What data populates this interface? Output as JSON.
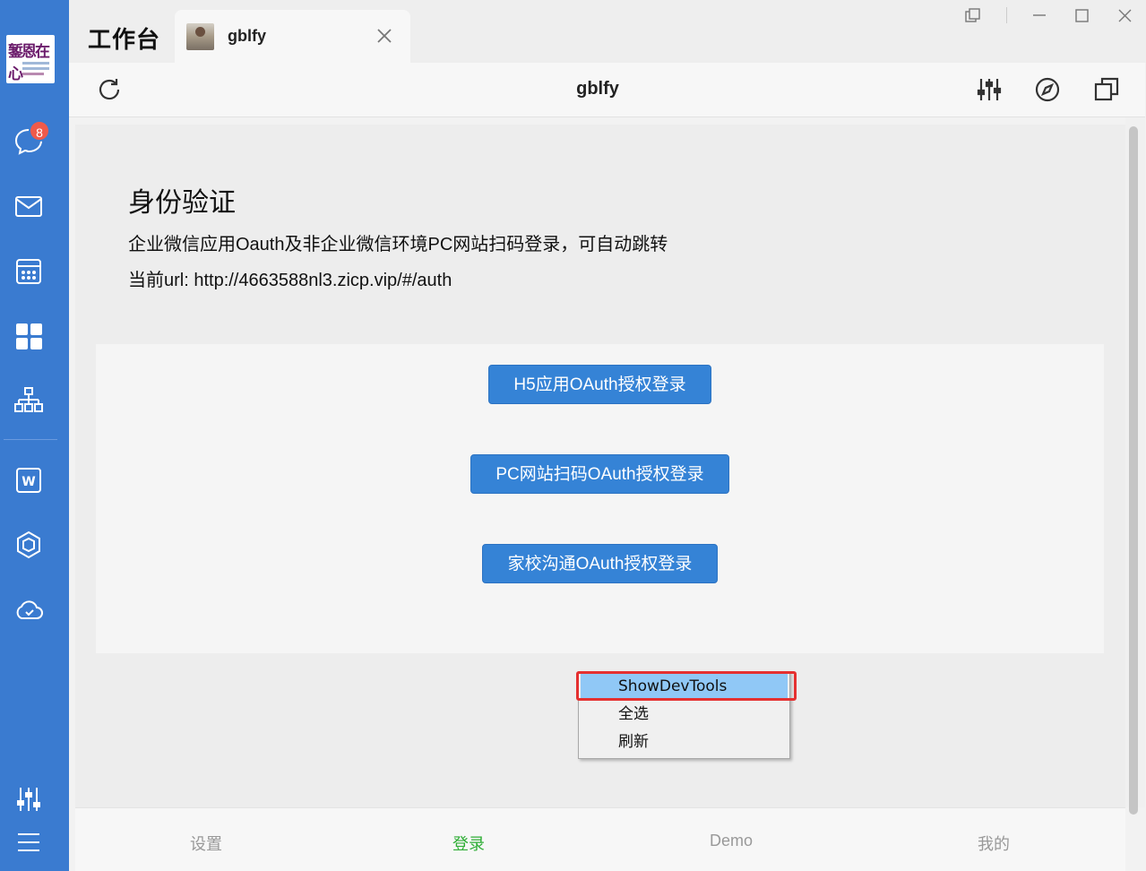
{
  "sidebar": {
    "avatar_text": "錾恩在心",
    "unread_badge": "8",
    "icons": [
      "chat-icon",
      "mail-icon",
      "calendar-icon",
      "workbench-icon",
      "org-chart-icon",
      "wedoc-icon",
      "cube-icon",
      "cloud-icon",
      "settings-sliders-icon",
      "menu-icon"
    ]
  },
  "titlebar": {
    "app_title": "工作台",
    "tab_label": "gblfy"
  },
  "toolbar": {
    "page_title": "gblfy"
  },
  "page": {
    "heading": "身份验证",
    "description": "企业微信应用Oauth及非企业微信环境PC网站扫码登录，可自动跳转",
    "current_url": "当前url: http://4663588nl3.zicp.vip/#/auth",
    "buttons": {
      "h5_oauth": "H5应用OAuth授权登录",
      "pc_scan_oauth": "PC网站扫码OAuth授权登录",
      "school_oauth": "家校沟通OAuth授权登录"
    }
  },
  "context_menu": {
    "items": [
      "ShowDevTools",
      "全选",
      "刷新"
    ],
    "highlighted": "ShowDevTools"
  },
  "bottom_nav": {
    "items": [
      "设置",
      "登录",
      "Demo",
      "我的"
    ],
    "active": "登录"
  },
  "colors": {
    "sidebar": "#3a7bd0",
    "button": "#3583d6",
    "active_nav": "#2fae36",
    "badge": "#f05a4a",
    "highlight_box": "#e53030"
  }
}
